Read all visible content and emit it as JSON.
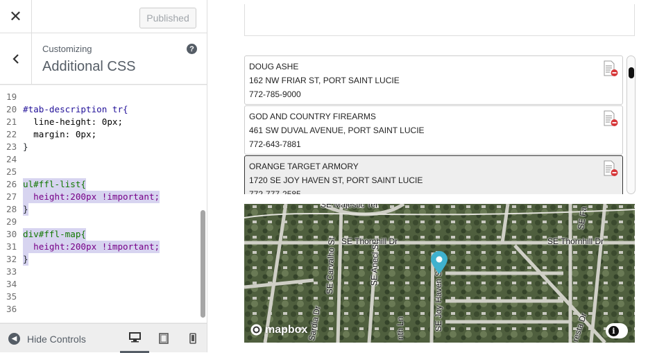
{
  "header": {
    "close_icon": "close-icon",
    "published_label": "Published"
  },
  "section": {
    "back_icon": "chevron-left-icon",
    "customizing_label": "Customizing",
    "title": "Additional CSS",
    "help_icon": "help-icon"
  },
  "editor": {
    "lines": [
      {
        "num": "19",
        "text": ""
      },
      {
        "num": "20",
        "text": "#tab-description tr{"
      },
      {
        "num": "21",
        "text": "  line-height: 0px;"
      },
      {
        "num": "22",
        "text": "  margin: 0px;"
      },
      {
        "num": "23",
        "text": "}"
      },
      {
        "num": "24",
        "text": ""
      },
      {
        "num": "25",
        "text": ""
      },
      {
        "num": "26",
        "text": "ul#ffl-list{"
      },
      {
        "num": "27",
        "text": "  height:200px !important;"
      },
      {
        "num": "28",
        "text": "}"
      },
      {
        "num": "29",
        "text": ""
      },
      {
        "num": "30",
        "text": "div#ffl-map{"
      },
      {
        "num": "31",
        "text": "  height:200px !important;"
      },
      {
        "num": "32",
        "text": "}"
      },
      {
        "num": "33",
        "text": ""
      },
      {
        "num": "34",
        "text": ""
      },
      {
        "num": "35",
        "text": ""
      },
      {
        "num": "36",
        "text": ""
      }
    ]
  },
  "footer": {
    "hide_controls_label": "Hide Controls",
    "devices": [
      "desktop-icon",
      "tablet-icon",
      "mobile-icon"
    ]
  },
  "ffl_list": [
    {
      "name": "DOUG ASHE",
      "address": "162 NW FRIAR ST, PORT SAINT LUCIE",
      "phone": "772-785-9000"
    },
    {
      "name": "GOD AND COUNTRY FIREARMS",
      "address": "461 SW DUVAL AVENUE, PORT SAINT LUCIE",
      "phone": "772-643-7881"
    },
    {
      "name": "ORANGE TARGET ARMORY",
      "address": "1720 SE JOY HAVEN ST, PORT SAINT LUCIE",
      "phone": "772-777-2585"
    }
  ],
  "map": {
    "streets": {
      "majestic": "SE Majestic Ter",
      "thornhill_left": "SE Thornhill Dr",
      "thornhill_right": "SE Thornhill Dr",
      "carvalho": "SE Carvalho St",
      "anecl": "SE Anecl St",
      "joy_haven": "SE Joy Haven St",
      "sardia": "Sardia Dr",
      "nth": "nth Ln",
      "resta": "resta Dr",
      "fa": "SE Fa"
    },
    "logo": "mapbox",
    "info_icon": "info-icon",
    "pin_color": "#3fb1ce"
  }
}
